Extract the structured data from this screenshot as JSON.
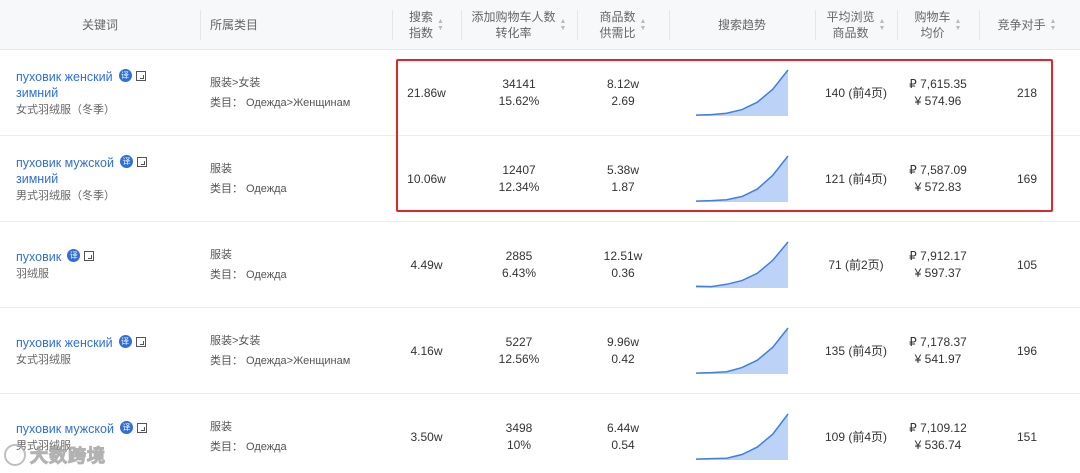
{
  "header": {
    "keyword": "关键词",
    "category": "所属类目",
    "search_index": [
      "搜索",
      "指数"
    ],
    "cart_rate": [
      "添加购物车人数",
      "转化率"
    ],
    "supply_ratio": [
      "商品数",
      "供需比"
    ],
    "search_trend": "搜索趋势",
    "avg_browse": [
      "平均浏览",
      "商品数"
    ],
    "cart_price": [
      "购物车",
      "均价"
    ],
    "competitors": "竞争对手"
  },
  "icons": {
    "translate": "译",
    "translate_icon": "translate-icon",
    "copy_icon": "copy-icon",
    "sort_icon": "sort-icon"
  },
  "rows": [
    {
      "keyword": "пуховик женский зимний",
      "keyword_lines": [
        "пуховик женский",
        "зимний"
      ],
      "translation": "女式羽绒服（冬季）",
      "cat_path": "服装>女装",
      "cat_ru": "类目：  Одежда>Женщинам",
      "search_index": "21.86w",
      "cart_count": "34141",
      "cart_rate": "15.62%",
      "items": "8.12w",
      "supply_ratio": "2.69",
      "trend": [
        2,
        3,
        6,
        14,
        30,
        58,
        100
      ],
      "avg_browse": "140 (前4页)",
      "price_rub": "₽ 7,615.35",
      "price_cny": "¥  574.96",
      "competitors": "218"
    },
    {
      "keyword": "пуховик мужской зимний",
      "keyword_lines": [
        "пуховик мужской",
        "зимний"
      ],
      "translation": "男式羽绒服（冬季）",
      "cat_path": "服装",
      "cat_ru": "类目：  Одежда",
      "search_index": "10.06w",
      "cart_count": "12407",
      "cart_rate": "12.34%",
      "items": "5.38w",
      "supply_ratio": "1.87",
      "trend": [
        2,
        3,
        5,
        12,
        28,
        58,
        100
      ],
      "avg_browse": "121 (前4页)",
      "price_rub": "₽ 7,587.09",
      "price_cny": "¥  572.83",
      "competitors": "169"
    },
    {
      "keyword": "пуховик",
      "keyword_lines": [
        "пуховик"
      ],
      "translation": "羽绒服",
      "cat_path": "服装",
      "cat_ru": "类目：  Одежда",
      "search_index": "4.49w",
      "cart_count": "2885",
      "cart_rate": "6.43%",
      "items": "12.51w",
      "supply_ratio": "0.36",
      "trend": [
        4,
        3,
        8,
        16,
        32,
        60,
        100
      ],
      "avg_browse": "71 (前2页)",
      "price_rub": "₽ 7,912.17",
      "price_cny": "¥  597.37",
      "competitors": "105"
    },
    {
      "keyword": "пуховик женский",
      "keyword_lines": [
        "пуховик женский"
      ],
      "translation": "女式羽绒服",
      "cat_path": "服装>女装",
      "cat_ru": "类目：  Одежда>Женщинам",
      "search_index": "4.16w",
      "cart_count": "5227",
      "cart_rate": "12.56%",
      "items": "9.96w",
      "supply_ratio": "0.42",
      "trend": [
        2,
        3,
        5,
        14,
        30,
        58,
        100
      ],
      "avg_browse": "135 (前4页)",
      "price_rub": "₽ 7,178.37",
      "price_cny": "¥  541.97",
      "competitors": "196"
    },
    {
      "keyword": "пуховик мужской",
      "keyword_lines": [
        "пуховик мужской"
      ],
      "translation": "男式羽绒服",
      "cat_path": "服装",
      "cat_ru": "类目：  Одежда",
      "search_index": "3.50w",
      "cart_count": "3498",
      "cart_rate": "10%",
      "items": "6.44w",
      "supply_ratio": "0.54",
      "trend": [
        2,
        3,
        4,
        12,
        28,
        56,
        100
      ],
      "avg_browse": "109 (前4页)",
      "price_rub": "₽ 7,109.12",
      "price_cny": "¥  536.74",
      "competitors": "151"
    }
  ],
  "watermark": {
    "text": "大数跨境"
  },
  "colors": {
    "accent": "#2f6fd6",
    "highlight": "#e0262b",
    "trend_line": "#3f7fe6",
    "trend_fill": "#bcd3f7"
  }
}
